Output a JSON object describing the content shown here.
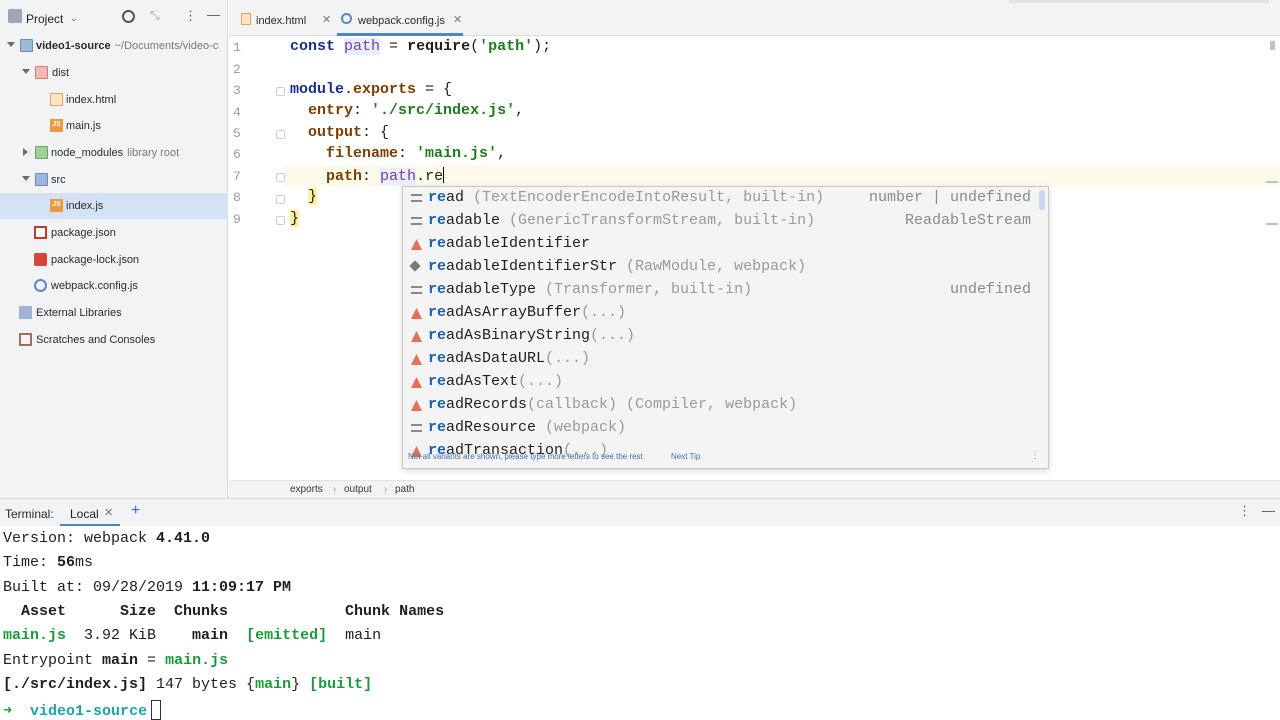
{
  "project_panel": {
    "title": "Project",
    "tree": [
      {
        "label": "video1-source",
        "sub": "~/Documents/video-c",
        "bold": true
      },
      {
        "label": "dist"
      },
      {
        "label": "index.html"
      },
      {
        "label": "main.js"
      },
      {
        "label": "node_modules",
        "sub": "library root"
      },
      {
        "label": "src"
      },
      {
        "label": "index.js"
      },
      {
        "label": "package.json"
      },
      {
        "label": "package-lock.json"
      },
      {
        "label": "webpack.config.js"
      },
      {
        "label": "External Libraries"
      },
      {
        "label": "Scratches and Consoles"
      }
    ]
  },
  "tabs": [
    {
      "label": "index.html"
    },
    {
      "label": "webpack.config.js"
    }
  ],
  "editor": {
    "line_numbers": [
      "1",
      "2",
      "3",
      "4",
      "5",
      "6",
      "7",
      "8",
      "9"
    ]
  },
  "completion": {
    "items": [
      {
        "match": "re",
        "rest": "ad",
        "detail": " (TextEncoderEncodeIntoResult, built-in)",
        "type": "number | undefined",
        "icon": "field-icon"
      },
      {
        "match": "re",
        "rest": "adable",
        "detail": " (GenericTransformStream, built-in)",
        "type": "ReadableStream",
        "icon": "field-icon"
      },
      {
        "match": "re",
        "rest": "adableIdentifier",
        "detail": "",
        "type": "",
        "icon": "method-icon"
      },
      {
        "match": "re",
        "rest": "adableIdentifierStr",
        "detail": " (RawModule, webpack)",
        "type": "",
        "icon": "tag-icon"
      },
      {
        "match": "re",
        "rest": "adableType",
        "detail": " (Transformer, built-in)",
        "type": "undefined",
        "icon": "field-icon"
      },
      {
        "match": "re",
        "rest": "adAsArrayBuffer",
        "detail": "(...)",
        "type": "",
        "icon": "method-icon"
      },
      {
        "match": "re",
        "rest": "adAsBinaryString",
        "detail": "(...)",
        "type": "",
        "icon": "method-icon"
      },
      {
        "match": "re",
        "rest": "adAsDataURL",
        "detail": "(...)",
        "type": "",
        "icon": "method-icon"
      },
      {
        "match": "re",
        "rest": "adAsText",
        "detail": "(...)",
        "type": "",
        "icon": "method-icon"
      },
      {
        "match": "re",
        "rest": "adRecords",
        "detail": "(callback) (Compiler, webpack)",
        "type": "",
        "icon": "method-icon"
      },
      {
        "match": "re",
        "rest": "adResource",
        "detail": " (webpack)",
        "type": "",
        "icon": "field-icon"
      },
      {
        "match": "re",
        "rest": "adTransaction",
        "detail": "(...)",
        "type": "",
        "icon": "method-icon"
      }
    ],
    "footer_hint": "Not all variants are shown, please type more letters to see the rest",
    "footer_tip": "Next Tip"
  },
  "breadcrumb": [
    "exports",
    "output",
    "path"
  ],
  "terminal": {
    "label": "Terminal:",
    "tab": "Local",
    "lines": {
      "version_prefix": "Version: webpack ",
      "version": "4.41.0",
      "time_prefix": "Time: ",
      "time_value": "56",
      "time_unit": "ms",
      "built_prefix": "Built at: 09/28/2019 ",
      "built_time": "11:09:17 PM",
      "table_header": "  Asset      Size  Chunks             Chunk Names",
      "asset": "main.js",
      "size": "  3.92 KiB    ",
      "chunk": "main",
      "emitted": "  [emitted]",
      "chunk_name": "  main",
      "entry_prefix": "Entrypoint ",
      "entry_name": "main",
      "entry_eq": " = ",
      "entry_file": "main.js",
      "module_prefix": "[./src/index.js]",
      "module_size": " 147 bytes {",
      "module_chunk": "main",
      "module_close": "} ",
      "module_built": "[built]",
      "prompt_arrow": "➜",
      "prompt_dir": "video1-source"
    }
  },
  "colors": {
    "accent": "#4a88c7",
    "selection": "#d5e1f5",
    "terminal_green": "#1c9b3a",
    "terminal_cyan": "#1ea3a8"
  }
}
